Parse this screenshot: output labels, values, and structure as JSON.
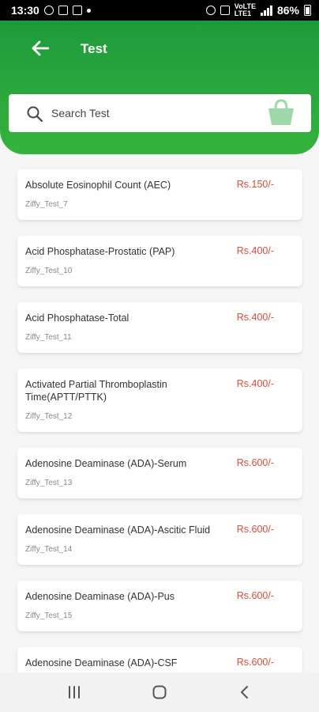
{
  "status_bar": {
    "time": "13:30",
    "network_small_top": "VoLTE",
    "network_small_bottom": "LTE1",
    "battery": "86%"
  },
  "header": {
    "title": "Test",
    "back_icon": "arrow-left-icon"
  },
  "search": {
    "placeholder": "Search Test",
    "cart_icon": "shopping-basket-icon"
  },
  "tests": [
    {
      "name": "Absolute Eosinophil Count (AEC)",
      "code": "Ziffy_Test_7",
      "price": "Rs.150/-"
    },
    {
      "name": "Acid Phosphatase-Prostatic (PAP)",
      "code": "Ziffy_Test_10",
      "price": "Rs.400/-"
    },
    {
      "name": "Acid Phosphatase-Total",
      "code": "Ziffy_Test_11",
      "price": "Rs.400/-"
    },
    {
      "name": "Activated Partial Thromboplastin Time(APTT/PTTK)",
      "code": "Ziffy_Test_12",
      "price": "Rs.400/-"
    },
    {
      "name": "Adenosine Deaminase (ADA)-Serum",
      "code": "Ziffy_Test_13",
      "price": "Rs.600/-"
    },
    {
      "name": "Adenosine Deaminase (ADA)-Ascitic Fluid",
      "code": "Ziffy_Test_14",
      "price": "Rs.600/-"
    },
    {
      "name": "Adenosine Deaminase (ADA)-Pus",
      "code": "Ziffy_Test_15",
      "price": "Rs.600/-"
    },
    {
      "name": "Adenosine Deaminase (ADA)-CSF",
      "code": "",
      "price": "Rs.600/-"
    }
  ],
  "colors": {
    "header_green": "#2aa83c",
    "price_red": "#e04b3a",
    "cart_icon": "#9fd8a8"
  },
  "nav": {
    "recents_icon": "recent-apps-icon",
    "home_icon": "home-icon",
    "back_icon": "back-chevron-icon"
  }
}
